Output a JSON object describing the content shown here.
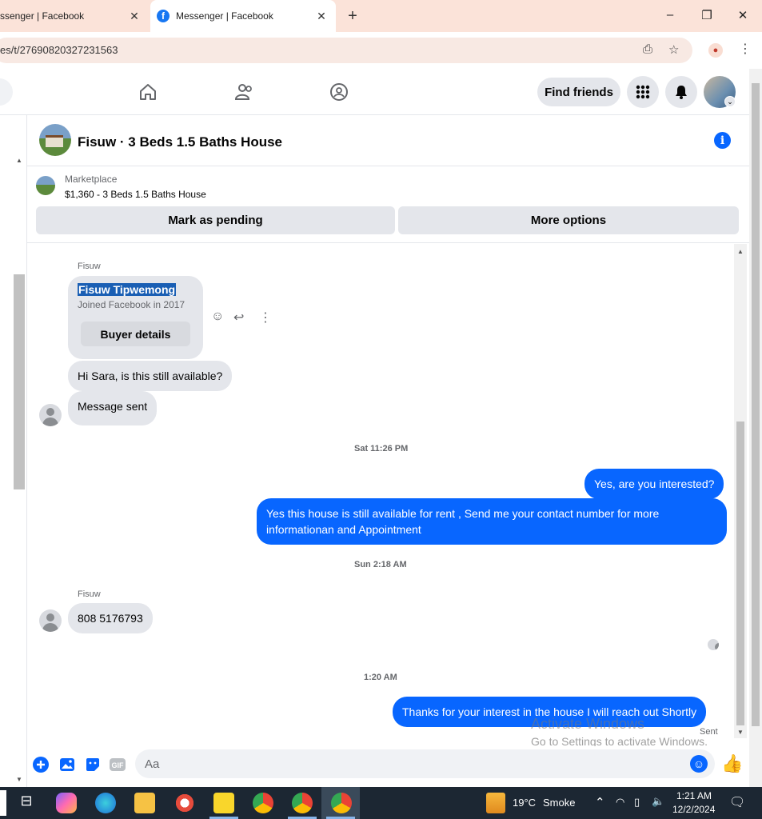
{
  "browser": {
    "tabs": [
      {
        "title": "ssenger | Facebook",
        "active": false
      },
      {
        "title": "Messenger | Facebook",
        "active": true
      }
    ],
    "url": "es/t/27690820327231563",
    "new_tab": "+",
    "window_controls": {
      "minimize": "–",
      "restore": "❐",
      "close": "✕"
    }
  },
  "fb_nav": {
    "find_friends": "Find friends"
  },
  "conversation": {
    "title": "Fisuw · 3 Beds 1.5 Baths House",
    "info_glyph": "i"
  },
  "marketplace": {
    "label": "Marketplace",
    "listing": "$1,360 - 3 Beds 1.5 Baths House",
    "mark_pending": "Mark as pending",
    "more_options": "More options"
  },
  "messages": {
    "sender_name_1": "Fisuw",
    "profile_name": "Fisuw Tipwemong",
    "profile_joined": "Joined Facebook in 2017",
    "buyer_details": "Buyer details",
    "msg_1": "Hi Sara, is this still available?",
    "msg_2": "Message sent",
    "ts_1": "Sat 11:26 PM",
    "out_1": "Yes, are you interested?",
    "out_2": "Yes this house is still available for rent , Send me your contact number for more informationan and Appointment",
    "ts_2": "Sun 2:18 AM",
    "sender_name_2": "Fisuw",
    "msg_3": "808 5176793",
    "ts_3": "1:20 AM",
    "out_3": "Thanks for your interest in the house I will reach out Shortly",
    "sent_label": "Sent"
  },
  "composer": {
    "placeholder": "Aa",
    "gif_label": "GIF"
  },
  "watermark": {
    "line1": "Activate Windows",
    "line2": "Go to Settings to activate Windows."
  },
  "taskbar": {
    "weather_temp": "19°C",
    "weather_desc": "Smoke",
    "time": "1:21 AM",
    "date": "12/2/2024"
  },
  "colors": {
    "messenger_blue": "#0866ff",
    "fb_blue": "#1877f2",
    "bubble_gray": "#e4e6eb"
  }
}
